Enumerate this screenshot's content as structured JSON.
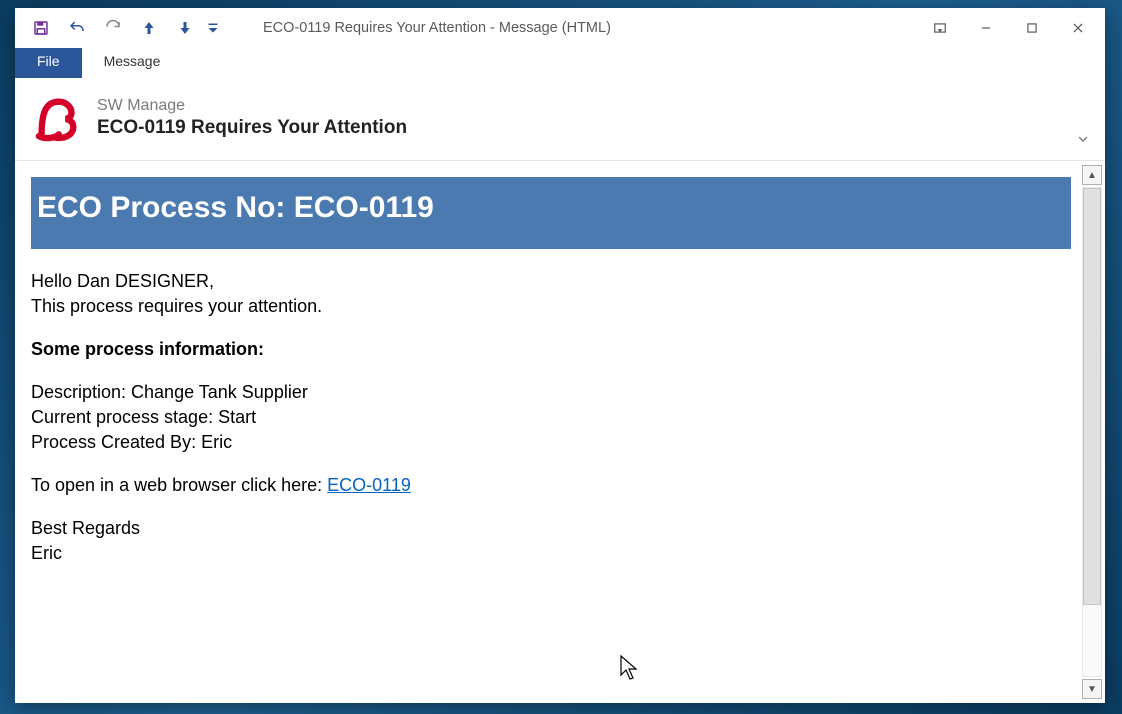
{
  "window": {
    "title": "ECO-0119 Requires Your Attention - Message (HTML)"
  },
  "ribbon": {
    "file": "File",
    "message": "Message"
  },
  "header": {
    "sender": "SW Manage",
    "subject": "ECO-0119 Requires Your Attention"
  },
  "body": {
    "banner": "ECO Process No: ECO-0119",
    "greeting": "Hello Dan DESIGNER,",
    "line2": "This process requires your attention.",
    "info_head": "Some process information:",
    "desc": "Description: Change Tank Supplier",
    "stage": "Current process stage: Start",
    "created_by": "Process Created By: Eric",
    "open_prefix": "To open in a web browser click here: ",
    "open_link": "ECO-0119",
    "regards1": "Best Regards",
    "regards2": "Eric"
  }
}
